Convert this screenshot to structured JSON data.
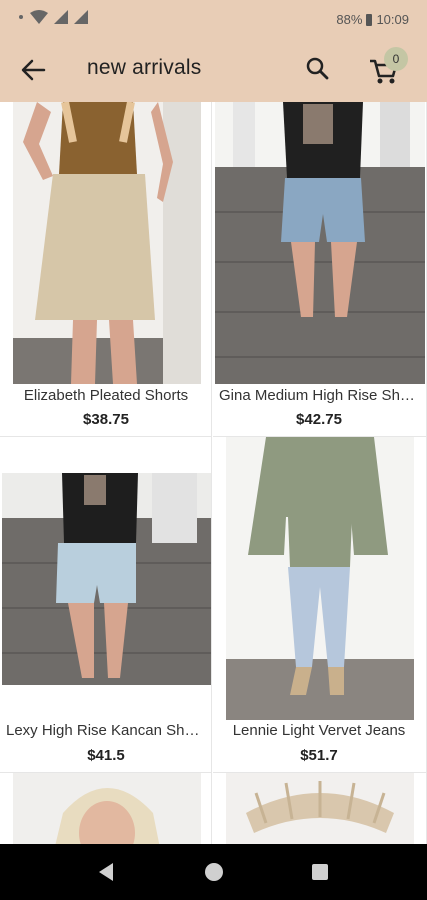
{
  "status_bar": {
    "battery": "88%",
    "time": "10:09"
  },
  "app_bar": {
    "title": "new arrivals",
    "cart_count": "0"
  },
  "products": [
    {
      "name": "Elizabeth Pleated Shorts",
      "price": "$38.75"
    },
    {
      "name": "Gina Medium High Rise Shorts",
      "price": "$42.75"
    },
    {
      "name": "Lexy High Rise Kancan Shorts",
      "price": "$41.5"
    },
    {
      "name": "Lennie Light Vervet Jeans",
      "price": "$51.7"
    }
  ],
  "colors": {
    "app_bar": "#e8cdb6",
    "cart_badge": "#c4c6a4"
  },
  "icons": [
    "back-arrow-icon",
    "search-icon",
    "cart-icon",
    "nav-back-icon",
    "nav-home-icon",
    "nav-recent-icon"
  ]
}
